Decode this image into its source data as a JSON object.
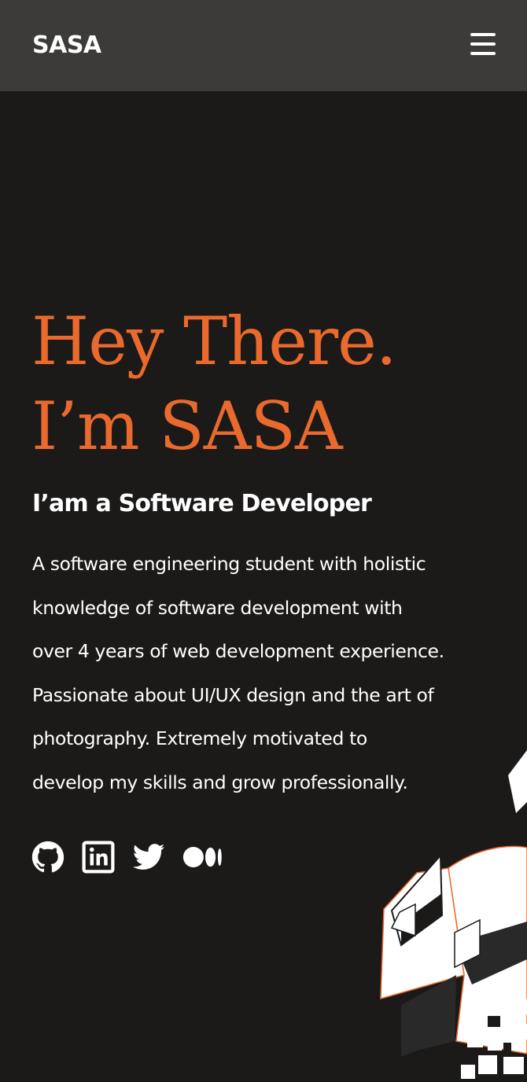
{
  "nav": {
    "brand": "SASA",
    "menu_icon": "hamburger-menu-icon"
  },
  "hero": {
    "greeting_line1": "Hey There.",
    "greeting_line2": "I’m SASA",
    "subtitle": "I’am a Software Developer",
    "bio_lines": [
      "A software engineering student with holistic",
      "knowledge of software development with",
      "over 4 years of web development experience.",
      "Passionate about UI/UX design and the art of",
      "photography. Extremely motivated to",
      "develop my skills and grow professionally."
    ]
  },
  "socials": [
    {
      "icon": "github-icon"
    },
    {
      "icon": "linkedin-icon"
    },
    {
      "icon": "twitter-icon"
    },
    {
      "icon": "medium-icon"
    }
  ],
  "colors": {
    "background": "#1c1a19",
    "navbar": "#3c3b3a",
    "accent": "#ea6a2e",
    "text": "#ffffff"
  }
}
